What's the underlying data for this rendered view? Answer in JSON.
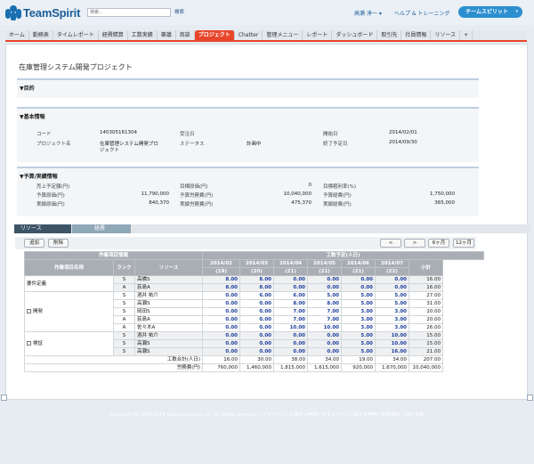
{
  "header": {
    "logo_text": "TeamSpirit",
    "search_placeholder": "検索...",
    "search_button": "検索",
    "user": "高瀬 淳一 ▾",
    "help": "ヘルプ & トレーニング",
    "app_menu": "チームスピリット",
    "app_menu_caret": "▾"
  },
  "tabs": [
    "ホーム",
    "勤務表",
    "タイムレポート",
    "経費精算",
    "工数実績",
    "稟議",
    "商談",
    "プロジェクト",
    "Chatter",
    "管理メニュー",
    "レポート",
    "ダッシュボード",
    "取引先",
    "社員情報",
    "リソース",
    "+"
  ],
  "active_tab": "プロジェクト",
  "page": {
    "title": "在庫管理システム開発プロジェクト"
  },
  "purpose": {
    "title": "▼目的"
  },
  "basic": {
    "title": "▼基本情報",
    "code_label": "コード",
    "code": "140305161304",
    "order_label": "受注日",
    "start_label": "開始日",
    "start": "2014/02/01",
    "name_label": "プロジェクト名",
    "name_line1": "在庫管理システム開発プロ",
    "name_line2": "ジェクト",
    "status_label": "ステータス",
    "status": "計画中",
    "end_label": "終了予定日",
    "end": "2014/09/30"
  },
  "budget": {
    "title": "▼予算/実績情報",
    "r1": [
      [
        "売上予定額(円)",
        ""
      ],
      [
        "目標原価(円)",
        "0"
      ],
      [
        "目標粗利率(%)",
        ""
      ]
    ],
    "r2": [
      [
        "予算原価(円)",
        "11,790,000"
      ],
      [
        "予算労務費(円)",
        "10,040,000"
      ],
      [
        "予算経費(円)",
        "1,750,000"
      ]
    ],
    "r3": [
      [
        "実績原価(円)",
        "840,370"
      ],
      [
        "実績労務費(円)",
        "475,370"
      ],
      [
        "実績経費(円)",
        "365,000"
      ]
    ]
  },
  "resource_tabs": {
    "resource": "リソース",
    "expense": "経費"
  },
  "toolbar": {
    "add": "追加",
    "delete": "削除",
    "prev": "<",
    "next": ">",
    "six": "6ヶ月",
    "twelve": "12ヶ月"
  },
  "table": {
    "group_header": "作業項目情報",
    "plan_header": "工数予定(人日)",
    "col_item": "作業項目名称",
    "col_rank": "ランク",
    "col_resource": "リソース",
    "col_total": "小計",
    "months": [
      [
        "2014/02",
        "(19)"
      ],
      [
        "2014/03",
        "(20)"
      ],
      [
        "2014/04",
        "(21)"
      ],
      [
        "2014/05",
        "(21)"
      ],
      [
        "2014/06",
        "(21)"
      ],
      [
        "2014/07",
        "(22)"
      ]
    ],
    "groups": [
      {
        "name": "要件定義",
        "checkbox": false,
        "rows": [
          {
            "rank": "S",
            "res": "高橋S",
            "v": [
              "8.00",
              "8.00",
              "0.00",
              "0.00",
              "0.00",
              "0.00"
            ],
            "t": "16.00"
          },
          {
            "rank": "A",
            "res": "荻島A",
            "v": [
              "8.00",
              "8.00",
              "0.00",
              "0.00",
              "0.00",
              "0.00"
            ],
            "t": "16.00"
          }
        ]
      },
      {
        "name": "開発",
        "checkbox": true,
        "rows": [
          {
            "rank": "S",
            "res": "酒井 祐介",
            "v": [
              "0.00",
              "6.00",
              "6.00",
              "5.00",
              "5.00",
              "5.00"
            ],
            "t": "27.00"
          },
          {
            "rank": "S",
            "res": "高瀬S",
            "v": [
              "0.00",
              "0.00",
              "8.00",
              "8.00",
              "5.00",
              "5.00"
            ],
            "t": "31.00"
          },
          {
            "rank": "S",
            "res": "岡田S",
            "v": [
              "0.00",
              "0.00",
              "7.00",
              "7.00",
              "3.00",
              "3.00"
            ],
            "t": "20.00"
          },
          {
            "rank": "A",
            "res": "荻島A",
            "v": [
              "0.00",
              "0.00",
              "7.00",
              "7.00",
              "3.00",
              "3.00"
            ],
            "t": "20.00"
          },
          {
            "rank": "A",
            "res": "佐々木A",
            "v": [
              "0.00",
              "0.00",
              "10.00",
              "10.00",
              "3.00",
              "3.00"
            ],
            "t": "26.00"
          }
        ]
      },
      {
        "name": "検証",
        "checkbox": true,
        "rows": [
          {
            "rank": "S",
            "res": "酒井 祐介",
            "v": [
              "0.00",
              "0.00",
              "0.00",
              "0.00",
              "5.00",
              "10.00"
            ],
            "t": "15.00"
          },
          {
            "rank": "S",
            "res": "高瀬S",
            "v": [
              "0.00",
              "0.00",
              "0.00",
              "0.00",
              "5.00",
              "10.00"
            ],
            "t": "15.00"
          },
          {
            "rank": "S",
            "res": "高瀬S",
            "v": [
              "0.00",
              "0.00",
              "0.00",
              "0.00",
              "5.00",
              "16.00"
            ],
            "t": "21.00"
          }
        ]
      }
    ],
    "sum_label": "工数合計(人日)",
    "sum": [
      "16.00",
      "30.00",
      "38.00",
      "34.00",
      "19.00",
      "34.00"
    ],
    "sum_total": "207.00",
    "cost_label": "労務費(円)",
    "cost": [
      "760,000",
      "1,460,000",
      "1,815,000",
      "1,615,000",
      "920,000",
      "1,670,000"
    ],
    "cost_total": "10,040,000"
  },
  "footer": {
    "text": "Copyright © 2000-2014 salesforce.com, inc. All rights reserved. | プライバシーに関する声明 | セキュリティに関する声明 | 利用規約 | 508 準拠"
  },
  "colors": {
    "brand": "#1b5d97",
    "active_tab": "#e8462a",
    "header_bar": "#a9aeb4",
    "value_blue": "#1e3f9b",
    "background": "#e6ecf2"
  }
}
